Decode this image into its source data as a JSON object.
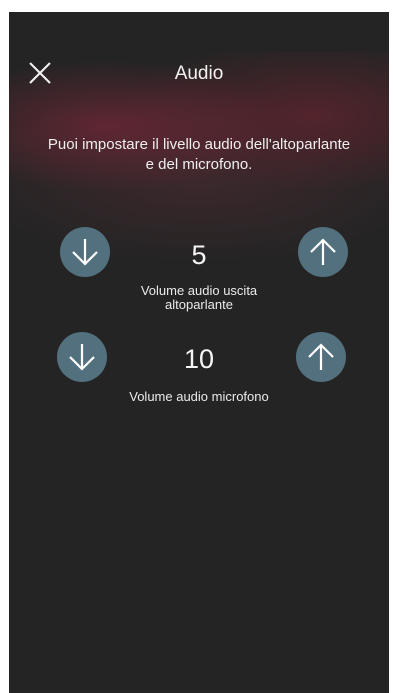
{
  "header": {
    "title": "Audio",
    "close_icon": "close-icon"
  },
  "description": {
    "line1": "Puoi impostare il livello audio dell'altoparlante",
    "line2": "e del microfono."
  },
  "speaker": {
    "value": "5",
    "label_line1": "Volume audio uscita",
    "label_line2": "altoparlante",
    "decrease_icon": "arrow-down-icon",
    "increase_icon": "arrow-up-icon"
  },
  "microphone": {
    "value": "10",
    "label": "Volume audio microfono",
    "decrease_icon": "arrow-down-icon",
    "increase_icon": "arrow-up-icon"
  },
  "colors": {
    "background": "#242424",
    "button": "#53707f",
    "glow": "#8c283c"
  }
}
